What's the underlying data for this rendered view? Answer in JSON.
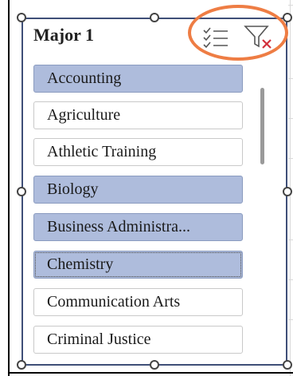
{
  "slicer": {
    "title": "Major 1",
    "icons": {
      "multi_select": "multi-select-icon",
      "clear_filter": "clear-filter-icon"
    },
    "accent_color": "#aebcdc",
    "highlight_color": "#ee7d44",
    "items": [
      {
        "label": "Accounting",
        "selected": true
      },
      {
        "label": "Agriculture",
        "selected": false
      },
      {
        "label": "Athletic Training",
        "selected": false
      },
      {
        "label": "Biology",
        "selected": true
      },
      {
        "label": "Business Administra...",
        "selected": true
      },
      {
        "label": "Chemistry",
        "selected": true,
        "focused": true
      },
      {
        "label": "Communication Arts",
        "selected": false
      },
      {
        "label": "Criminal Justice",
        "selected": false
      }
    ]
  }
}
